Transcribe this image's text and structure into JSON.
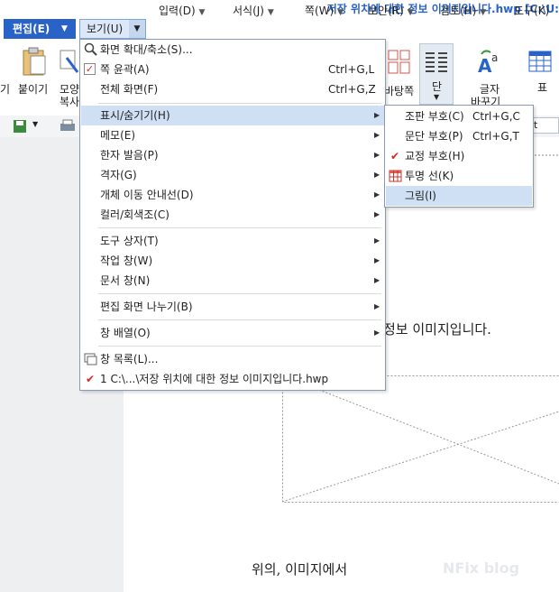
{
  "window": {
    "title": "저장 위치에 대한 정보 이미지입니다.hwp [C:\\U:"
  },
  "menubar": {
    "items": [
      {
        "label": "편집(E)"
      },
      {
        "label": "보기(U)"
      },
      {
        "label": "입력(D)"
      },
      {
        "label": "서식(J)"
      },
      {
        "label": "쪽(W)"
      },
      {
        "label": "보안(R)"
      },
      {
        "label": "검토(H)"
      },
      {
        "label": "도구(K)"
      }
    ]
  },
  "ribbon": {
    "left_cut": "기",
    "paste": "붙이기",
    "shape_copy_1": "모양",
    "shape_copy_2": "복사",
    "background": "바탕쪽",
    "column": "단",
    "char_change_1": "글자",
    "char_change_2": "바꾸기",
    "table": "표"
  },
  "toolbar2": {
    "font_size_cut": "pt"
  },
  "dropdown": {
    "items": [
      {
        "label": "화면 확대/축소(S)...",
        "shortcut": ""
      },
      {
        "label": "쪽 윤곽(A)",
        "shortcut": "Ctrl+G,L"
      },
      {
        "label": "전체 화면(F)",
        "shortcut": "Ctrl+G,Z"
      },
      {
        "label": "표시/숨기기(H)",
        "shortcut": ""
      },
      {
        "label": "메모(E)",
        "shortcut": ""
      },
      {
        "label": "한자 발음(P)",
        "shortcut": ""
      },
      {
        "label": "격자(G)",
        "shortcut": ""
      },
      {
        "label": "개체 이동 안내선(D)",
        "shortcut": ""
      },
      {
        "label": "컬러/회색조(C)",
        "shortcut": ""
      },
      {
        "label": "도구 상자(T)",
        "shortcut": ""
      },
      {
        "label": "작업 창(W)",
        "shortcut": ""
      },
      {
        "label": "문서 창(N)",
        "shortcut": ""
      },
      {
        "label": "편집 화면 나누기(B)",
        "shortcut": ""
      },
      {
        "label": "창 배열(O)",
        "shortcut": ""
      },
      {
        "label": "창 목록(L)...",
        "shortcut": ""
      },
      {
        "label": "1 C:\\...\\저장 위치에 대한 정보 이미지입니다.hwp",
        "shortcut": ""
      }
    ]
  },
  "submenu": {
    "items": [
      {
        "label": "조판 부호(C)",
        "shortcut": "Ctrl+G,C"
      },
      {
        "label": "문단 부호(P)",
        "shortcut": "Ctrl+G,T"
      },
      {
        "label": "교정 부호(H)",
        "shortcut": ""
      },
      {
        "label": "투명 선(K)",
        "shortcut": ""
      },
      {
        "label": "그림(I)",
        "shortcut": ""
      }
    ]
  },
  "document": {
    "line1": "정보 이미지입니다.",
    "line2": "위의, 이미지에서",
    "watermark": "NFix blog"
  },
  "colors": {
    "accent": "#2a63c8",
    "highlight": "#cfe0f5",
    "check": "#d22222"
  }
}
